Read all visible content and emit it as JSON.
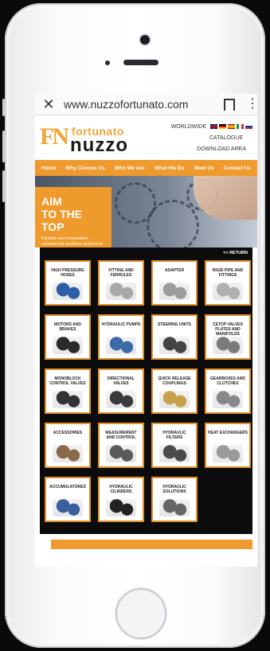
{
  "browser": {
    "url": "www.nuzzofortunato.com",
    "close_glyph": "✕",
    "menu_glyph": "⋮"
  },
  "brand": {
    "mark": "FN",
    "name_top": "fortunato",
    "name_bottom": "nuzzo",
    "accent_color": "#ef9a2c"
  },
  "header_links": {
    "worldwide": "WORLDWIDE",
    "catalogue": "CATALOGUE",
    "download": "DOWNLOAD AREA"
  },
  "nav": [
    "Home",
    "Why Choose Us",
    "Who We Are",
    "What We Do",
    "Meet Us",
    "Contact Us"
  ],
  "hero": {
    "title_line1": "AIM",
    "title_line2": "TO THE TOP",
    "subtitle": "Flexible and competitive commercial solutions tailored to your business."
  },
  "catalog": {
    "return_label": "<< RETURN",
    "tiles": [
      {
        "label": "HIGH PRESSURE HOSES",
        "color": "#2b5fa8"
      },
      {
        "label": "FITTING AND FERRULES",
        "color": "#a9a9a9"
      },
      {
        "label": "ADAPTER",
        "color": "#9c9c9c"
      },
      {
        "label": "RIGID PIPE AND FITTINGS",
        "color": "#b0b0b0"
      },
      {
        "label": "MOTORS AND BRAKES",
        "color": "#2b2b2b"
      },
      {
        "label": "HYDRAULIC PUMPS",
        "color": "#3a6aa8"
      },
      {
        "label": "STEERING UNITS",
        "color": "#444444"
      },
      {
        "label": "CETOP VALVES PLATES AND MANIFOLDS",
        "color": "#7a7a7a"
      },
      {
        "label": "MONOBLOCK CONTROL VALVES",
        "color": "#333333"
      },
      {
        "label": "DIRECTIONAL VALVES",
        "color": "#3a3a3a"
      },
      {
        "label": "QUICK RELEASE COUPLINGS",
        "color": "#c9a14a"
      },
      {
        "label": "GEARBOXES AND CLUTCHES",
        "color": "#888888"
      },
      {
        "label": "ACCESSORIES",
        "color": "#8a6a4a"
      },
      {
        "label": "MEASUREMENT AND CONTROL",
        "color": "#5a5a5a"
      },
      {
        "label": "HYDRAULIC FILTERS",
        "color": "#4a4a4a"
      },
      {
        "label": "HEAT EXCHANGERS",
        "color": "#9a9a9a"
      },
      {
        "label": "ACCUMULATORES",
        "color": "#3a5ea0"
      },
      {
        "label": "HYDRAULIC CILINDERS",
        "color": "#222222"
      },
      {
        "label": "HYDRAULIC SOLUTIONS",
        "color": "#666666"
      }
    ]
  }
}
